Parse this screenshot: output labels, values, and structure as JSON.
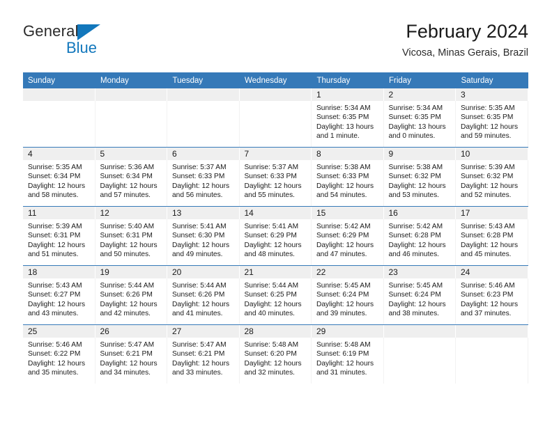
{
  "brand": {
    "name_top": "General",
    "name_bottom": "Blue",
    "color_dark": "#2b2b2b",
    "color_blue": "#1277bc"
  },
  "header": {
    "title": "February 2024",
    "subtitle": "Vicosa, Minas Gerais, Brazil"
  },
  "theme": {
    "header_blue": "#3579b8",
    "daynum_band": "#efefef",
    "cell_background": "#ffffff"
  },
  "calendar": {
    "weekday_headers": [
      "Sunday",
      "Monday",
      "Tuesday",
      "Wednesday",
      "Thursday",
      "Friday",
      "Saturday"
    ],
    "weeks": [
      [
        {
          "day": "",
          "lines": []
        },
        {
          "day": "",
          "lines": []
        },
        {
          "day": "",
          "lines": []
        },
        {
          "day": "",
          "lines": []
        },
        {
          "day": "1",
          "lines": [
            "Sunrise: 5:34 AM",
            "Sunset: 6:35 PM",
            "Daylight: 13 hours",
            "and 1 minute."
          ]
        },
        {
          "day": "2",
          "lines": [
            "Sunrise: 5:34 AM",
            "Sunset: 6:35 PM",
            "Daylight: 13 hours",
            "and 0 minutes."
          ]
        },
        {
          "day": "3",
          "lines": [
            "Sunrise: 5:35 AM",
            "Sunset: 6:35 PM",
            "Daylight: 12 hours",
            "and 59 minutes."
          ]
        }
      ],
      [
        {
          "day": "4",
          "lines": [
            "Sunrise: 5:35 AM",
            "Sunset: 6:34 PM",
            "Daylight: 12 hours",
            "and 58 minutes."
          ]
        },
        {
          "day": "5",
          "lines": [
            "Sunrise: 5:36 AM",
            "Sunset: 6:34 PM",
            "Daylight: 12 hours",
            "and 57 minutes."
          ]
        },
        {
          "day": "6",
          "lines": [
            "Sunrise: 5:37 AM",
            "Sunset: 6:33 PM",
            "Daylight: 12 hours",
            "and 56 minutes."
          ]
        },
        {
          "day": "7",
          "lines": [
            "Sunrise: 5:37 AM",
            "Sunset: 6:33 PM",
            "Daylight: 12 hours",
            "and 55 minutes."
          ]
        },
        {
          "day": "8",
          "lines": [
            "Sunrise: 5:38 AM",
            "Sunset: 6:33 PM",
            "Daylight: 12 hours",
            "and 54 minutes."
          ]
        },
        {
          "day": "9",
          "lines": [
            "Sunrise: 5:38 AM",
            "Sunset: 6:32 PM",
            "Daylight: 12 hours",
            "and 53 minutes."
          ]
        },
        {
          "day": "10",
          "lines": [
            "Sunrise: 5:39 AM",
            "Sunset: 6:32 PM",
            "Daylight: 12 hours",
            "and 52 minutes."
          ]
        }
      ],
      [
        {
          "day": "11",
          "lines": [
            "Sunrise: 5:39 AM",
            "Sunset: 6:31 PM",
            "Daylight: 12 hours",
            "and 51 minutes."
          ]
        },
        {
          "day": "12",
          "lines": [
            "Sunrise: 5:40 AM",
            "Sunset: 6:31 PM",
            "Daylight: 12 hours",
            "and 50 minutes."
          ]
        },
        {
          "day": "13",
          "lines": [
            "Sunrise: 5:41 AM",
            "Sunset: 6:30 PM",
            "Daylight: 12 hours",
            "and 49 minutes."
          ]
        },
        {
          "day": "14",
          "lines": [
            "Sunrise: 5:41 AM",
            "Sunset: 6:29 PM",
            "Daylight: 12 hours",
            "and 48 minutes."
          ]
        },
        {
          "day": "15",
          "lines": [
            "Sunrise: 5:42 AM",
            "Sunset: 6:29 PM",
            "Daylight: 12 hours",
            "and 47 minutes."
          ]
        },
        {
          "day": "16",
          "lines": [
            "Sunrise: 5:42 AM",
            "Sunset: 6:28 PM",
            "Daylight: 12 hours",
            "and 46 minutes."
          ]
        },
        {
          "day": "17",
          "lines": [
            "Sunrise: 5:43 AM",
            "Sunset: 6:28 PM",
            "Daylight: 12 hours",
            "and 45 minutes."
          ]
        }
      ],
      [
        {
          "day": "18",
          "lines": [
            "Sunrise: 5:43 AM",
            "Sunset: 6:27 PM",
            "Daylight: 12 hours",
            "and 43 minutes."
          ]
        },
        {
          "day": "19",
          "lines": [
            "Sunrise: 5:44 AM",
            "Sunset: 6:26 PM",
            "Daylight: 12 hours",
            "and 42 minutes."
          ]
        },
        {
          "day": "20",
          "lines": [
            "Sunrise: 5:44 AM",
            "Sunset: 6:26 PM",
            "Daylight: 12 hours",
            "and 41 minutes."
          ]
        },
        {
          "day": "21",
          "lines": [
            "Sunrise: 5:44 AM",
            "Sunset: 6:25 PM",
            "Daylight: 12 hours",
            "and 40 minutes."
          ]
        },
        {
          "day": "22",
          "lines": [
            "Sunrise: 5:45 AM",
            "Sunset: 6:24 PM",
            "Daylight: 12 hours",
            "and 39 minutes."
          ]
        },
        {
          "day": "23",
          "lines": [
            "Sunrise: 5:45 AM",
            "Sunset: 6:24 PM",
            "Daylight: 12 hours",
            "and 38 minutes."
          ]
        },
        {
          "day": "24",
          "lines": [
            "Sunrise: 5:46 AM",
            "Sunset: 6:23 PM",
            "Daylight: 12 hours",
            "and 37 minutes."
          ]
        }
      ],
      [
        {
          "day": "25",
          "lines": [
            "Sunrise: 5:46 AM",
            "Sunset: 6:22 PM",
            "Daylight: 12 hours",
            "and 35 minutes."
          ]
        },
        {
          "day": "26",
          "lines": [
            "Sunrise: 5:47 AM",
            "Sunset: 6:21 PM",
            "Daylight: 12 hours",
            "and 34 minutes."
          ]
        },
        {
          "day": "27",
          "lines": [
            "Sunrise: 5:47 AM",
            "Sunset: 6:21 PM",
            "Daylight: 12 hours",
            "and 33 minutes."
          ]
        },
        {
          "day": "28",
          "lines": [
            "Sunrise: 5:48 AM",
            "Sunset: 6:20 PM",
            "Daylight: 12 hours",
            "and 32 minutes."
          ]
        },
        {
          "day": "29",
          "lines": [
            "Sunrise: 5:48 AM",
            "Sunset: 6:19 PM",
            "Daylight: 12 hours",
            "and 31 minutes."
          ]
        },
        {
          "day": "",
          "lines": []
        },
        {
          "day": "",
          "lines": []
        }
      ]
    ]
  }
}
